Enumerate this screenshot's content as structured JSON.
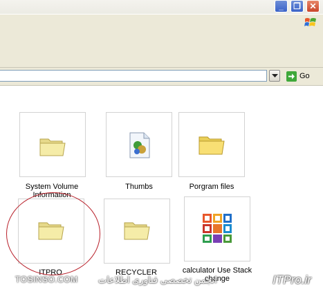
{
  "window_controls": {
    "minimize": "_",
    "maximize": "❐",
    "close": "✕"
  },
  "address_bar": {
    "value": "",
    "go_label": "Go"
  },
  "items": [
    {
      "name": "System Volume Information",
      "icon": "folder-icon"
    },
    {
      "name": "Thumbs",
      "icon": "thumbs-db-file-icon"
    },
    {
      "name": "Porgram files",
      "icon": "folder-icon"
    },
    {
      "name": "ITPRO",
      "icon": "folder-icon"
    },
    {
      "name": "RECYCLER",
      "icon": "folder-icon"
    },
    {
      "name": "calculator Use Stack change",
      "icon": "office-app-icon"
    }
  ],
  "watermark": {
    "left": "TOSINSO.COM",
    "mid": "انجمن تخصصی فناوری اطلاعات",
    "right": "ITPro.ir"
  },
  "colors": {
    "selection_circle": "#b8202a",
    "go_green": "#3fa83a"
  }
}
